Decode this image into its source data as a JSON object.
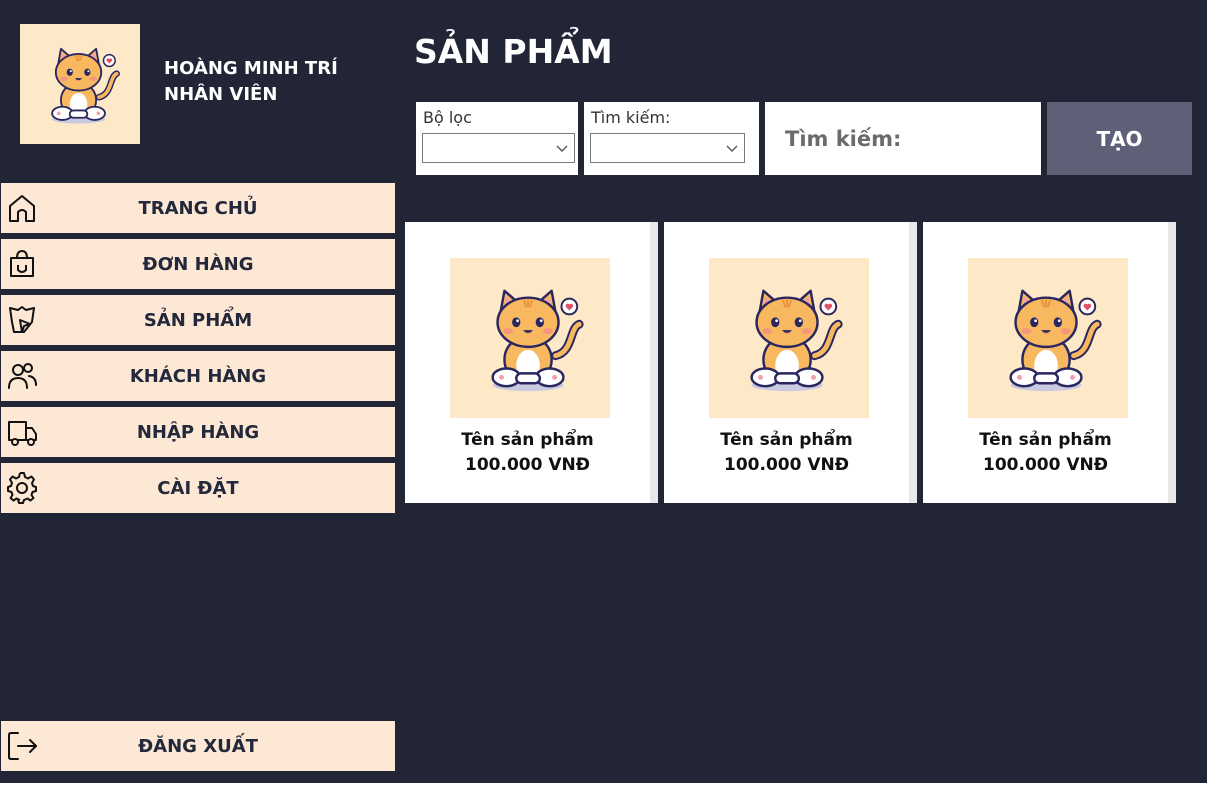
{
  "profile": {
    "name": "HOÀNG MINH TRÍ",
    "role": "NHÂN VIÊN",
    "avatar": "cat-avatar-icon"
  },
  "sidebar": {
    "items": [
      {
        "label": "TRANG CHỦ",
        "icon": "home-icon"
      },
      {
        "label": "ĐƠN HÀNG",
        "icon": "shopping-bag-icon"
      },
      {
        "label": "SẢN PHẨM",
        "icon": "product-icon"
      },
      {
        "label": "KHÁCH HÀNG",
        "icon": "users-icon"
      },
      {
        "label": "NHẬP HÀNG",
        "icon": "truck-icon"
      },
      {
        "label": "CÀI ĐẶT",
        "icon": "gear-icon"
      }
    ],
    "logout": {
      "label": "ĐĂNG XUẤT",
      "icon": "logout-icon"
    }
  },
  "header": {
    "title": "SẢN PHẨM"
  },
  "filters": {
    "filter_label": "Bộ lọc",
    "filter_value": "",
    "search_by_label": "Tìm kiếm:",
    "search_by_value": "",
    "search_placeholder": "Tìm kiếm:",
    "create_label": "TẠO"
  },
  "products": [
    {
      "name": "Tên sản phẩm",
      "price": "100.000 VNĐ"
    },
    {
      "name": "Tên sản phẩm",
      "price": "100.000 VNĐ"
    },
    {
      "name": "Tên sản phẩm",
      "price": "100.000 VNĐ"
    }
  ],
  "colors": {
    "background": "#222536",
    "nav_item": "#fde8d6",
    "accent_button": "#5f6078",
    "avatar_bg": "#fde8c8"
  }
}
